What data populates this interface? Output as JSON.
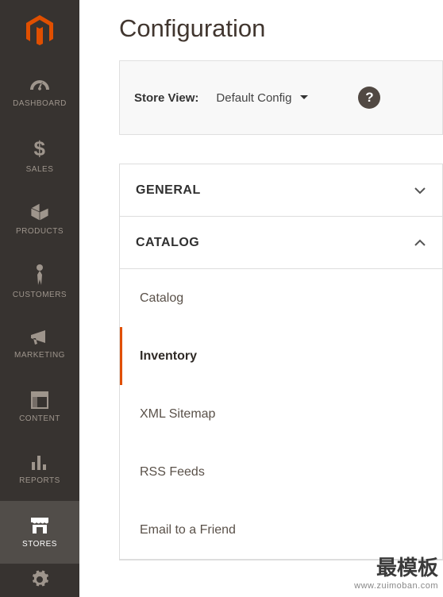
{
  "page": {
    "title": "Configuration"
  },
  "storeView": {
    "label": "Store View:",
    "selected": "Default Config"
  },
  "sidebar": {
    "items": [
      {
        "name": "dashboard",
        "label": "DASHBOARD"
      },
      {
        "name": "sales",
        "label": "SALES"
      },
      {
        "name": "products",
        "label": "PRODUCTS"
      },
      {
        "name": "customers",
        "label": "CUSTOMERS"
      },
      {
        "name": "marketing",
        "label": "MARKETING"
      },
      {
        "name": "content",
        "label": "CONTENT"
      },
      {
        "name": "reports",
        "label": "REPORTS"
      },
      {
        "name": "stores",
        "label": "STORES"
      }
    ]
  },
  "sections": {
    "general": {
      "label": "GENERAL"
    },
    "catalog": {
      "label": "CATALOG",
      "items": [
        {
          "label": "Catalog"
        },
        {
          "label": "Inventory"
        },
        {
          "label": "XML Sitemap"
        },
        {
          "label": "RSS Feeds"
        },
        {
          "label": "Email to a Friend"
        }
      ]
    }
  },
  "watermark": {
    "line1": "最模板",
    "line2": "www.zuimoban.com"
  }
}
